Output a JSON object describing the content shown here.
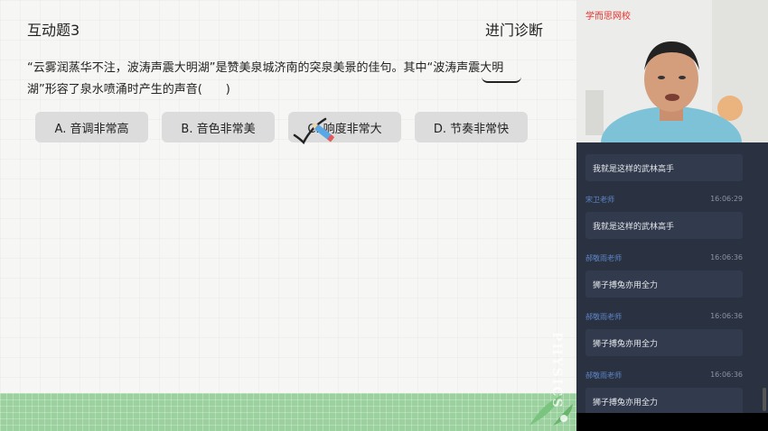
{
  "slide": {
    "title": "互动题3",
    "section": "进门诊断",
    "question_part1": "“云雾润蒸华不注，波涛声震大明湖”是赞美泉城济南的突泉美景的佳句。其中“",
    "question_highlight": "波涛声震大明",
    "question_part2": "湖”形容了泉水喷涌时产生的声音(　　)",
    "options": [
      {
        "label": "A. 音调非常高"
      },
      {
        "label": "B. 音色非常美"
      },
      {
        "label": "C. 响度非常大"
      },
      {
        "label": "D. 节奏非常快"
      }
    ],
    "watermark": "PHYSICS"
  },
  "video": {
    "brand": "学而思网校"
  },
  "chat": {
    "messages": [
      {
        "sender": "",
        "time": "",
        "text": "我就是这样的武林高手"
      },
      {
        "sender": "宋卫老师",
        "time": "16:06:29",
        "text": "我就是这样的武林高手"
      },
      {
        "sender": "郝敬雨老师",
        "time": "16:06:36",
        "text": "狮子搏兔亦用全力"
      },
      {
        "sender": "郝敬雨老师",
        "time": "16:06:36",
        "text": "狮子搏兔亦用全力"
      },
      {
        "sender": "郝敬雨老师",
        "time": "16:06:36",
        "text": "狮子搏兔亦用全力"
      }
    ]
  },
  "colors": {
    "slide_bg": "#f6f6f4",
    "option_bg": "#dcdcdc",
    "footer_green": "#9bd19e",
    "chat_bg": "#2a3242",
    "chat_sender": "#5f86c8",
    "brand_red": "#e5322d",
    "check_mark": "#222222",
    "pen_blue": "#5aa7e6"
  }
}
